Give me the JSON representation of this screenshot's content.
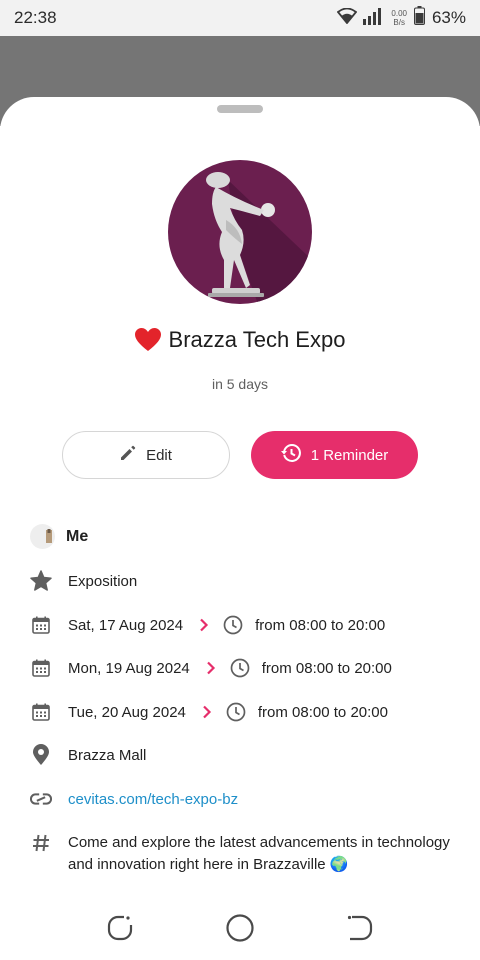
{
  "status_bar": {
    "time": "22:38",
    "net_speed_value": "0.00",
    "net_speed_unit": "B/s",
    "battery_percent": "63%"
  },
  "event": {
    "emoji": "heart",
    "title": "Brazza Tech Expo",
    "countdown": "in 5 days"
  },
  "actions": {
    "edit_label": "Edit",
    "reminder_label": "1 Reminder"
  },
  "details": {
    "owner": "Me",
    "category": "Exposition",
    "schedule": [
      {
        "date": "Sat, 17 Aug 2024",
        "time": "from 08:00 to 20:00"
      },
      {
        "date": "Mon, 19 Aug 2024",
        "time": "from 08:00 to 20:00"
      },
      {
        "date": "Tue, 20 Aug 2024",
        "time": "from 08:00 to 20:00"
      }
    ],
    "location": "Brazza Mall",
    "link": "cevitas.com/tech-expo-bz",
    "description": "Come and explore the latest advancements in technology and innovation right here in Brazzaville 🌍"
  },
  "colors": {
    "accent": "#e62e6b",
    "link": "#1e8fc9",
    "avatar_bg": "#6b1f4f"
  }
}
